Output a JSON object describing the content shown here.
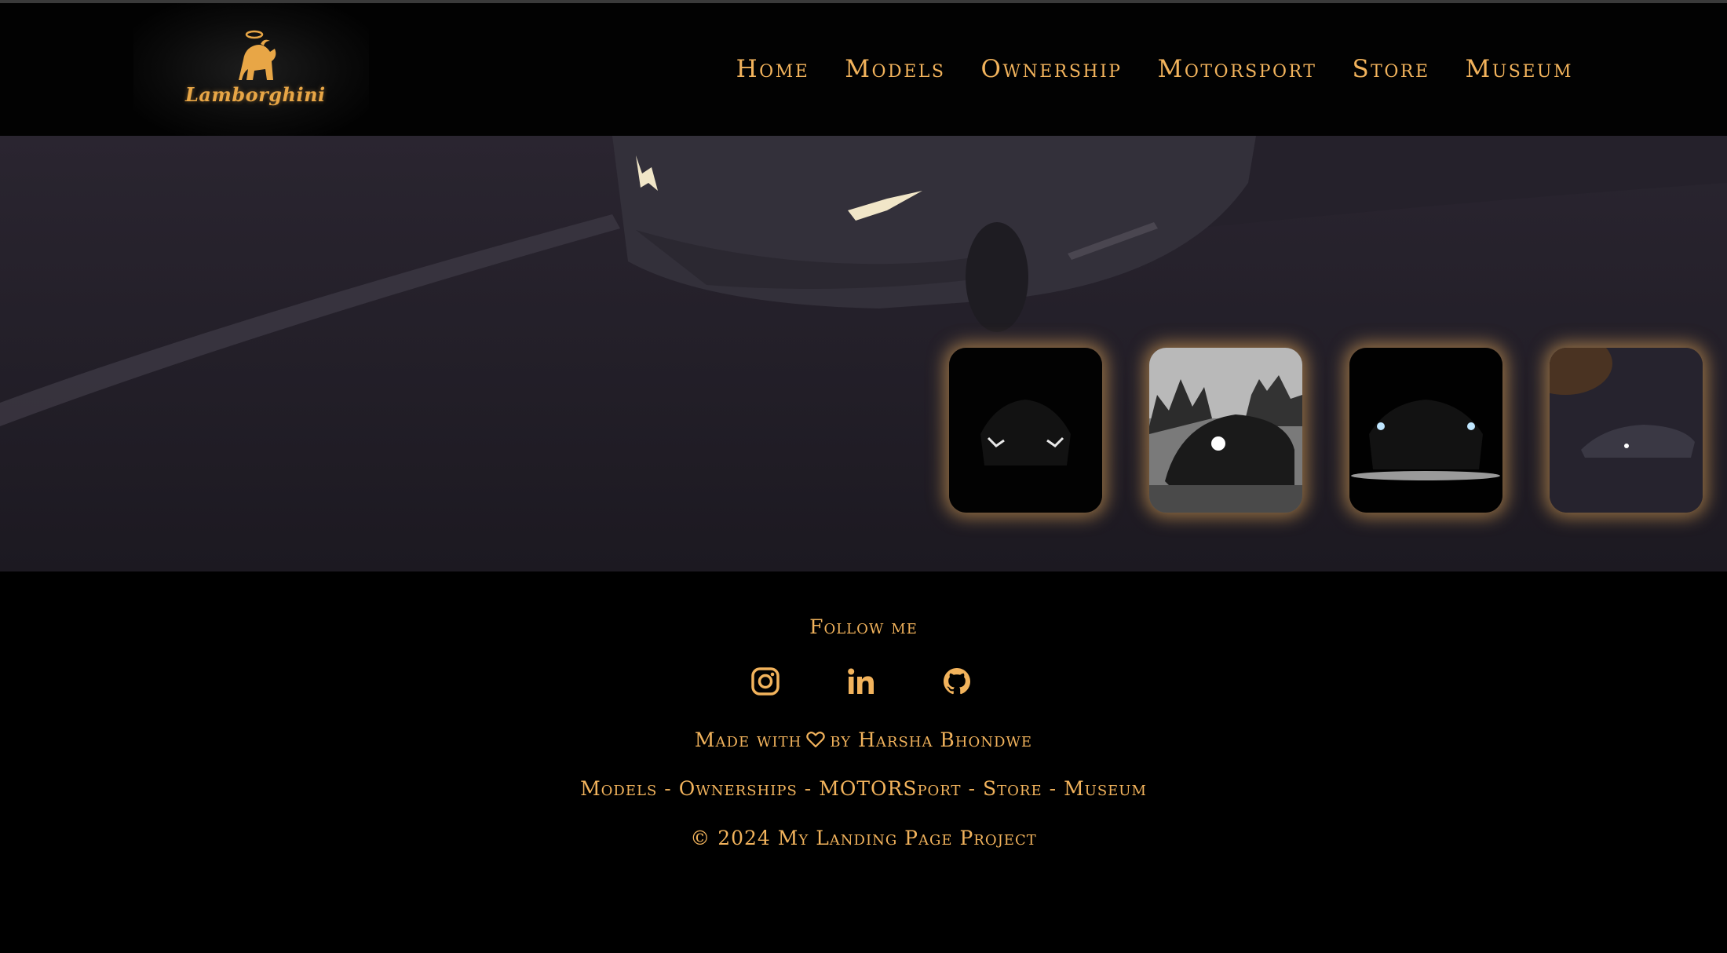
{
  "brand": {
    "logo_text": "Lamborghini",
    "logo_icon": "bull-shield-icon"
  },
  "nav": {
    "items": [
      {
        "label": "Home"
      },
      {
        "label": "Models"
      },
      {
        "label": "Ownership"
      },
      {
        "label": "Motorsport"
      },
      {
        "label": "Store"
      },
      {
        "label": "Museum"
      }
    ]
  },
  "hero": {
    "background": "dark-car-road-photo",
    "thumbnails": [
      {
        "name": "car-front-headlights-dark"
      },
      {
        "name": "car-front-grey-trees"
      },
      {
        "name": "car-front-lights-spotlit"
      },
      {
        "name": "car-side-night-road"
      }
    ]
  },
  "footer": {
    "follow_label": "Follow me",
    "socials": [
      {
        "icon": "instagram-icon"
      },
      {
        "icon": "linkedin-icon"
      },
      {
        "icon": "github-icon"
      }
    ],
    "made_prefix": "Made with",
    "made_suffix": "by Harsha Bhondwe",
    "heart_icon": "heart-icon",
    "links": [
      "Models",
      "Ownerships",
      "MOTORSport",
      "Store",
      "Museum"
    ],
    "link_separator": "-",
    "copyright": "© 2024 My Landing Page Project"
  },
  "colors": {
    "accent": "#f2b35c",
    "background": "#000000",
    "hero_bg": "#221e29"
  }
}
